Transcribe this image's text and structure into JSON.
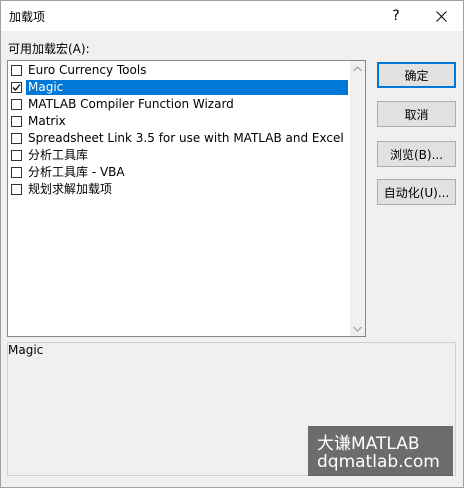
{
  "window": {
    "title": "加载项",
    "help_glyph": "?"
  },
  "addins": {
    "label": "可用加载宏(A):",
    "items": [
      {
        "label": "Euro Currency Tools",
        "checked": false,
        "selected": false
      },
      {
        "label": "Magic",
        "checked": true,
        "selected": true
      },
      {
        "label": "MATLAB Compiler Function Wizard",
        "checked": false,
        "selected": false
      },
      {
        "label": "Matrix",
        "checked": false,
        "selected": false
      },
      {
        "label": "Spreadsheet Link 3.5 for use with MATLAB and Excel",
        "checked": false,
        "selected": false
      },
      {
        "label": "分析工具库",
        "checked": false,
        "selected": false
      },
      {
        "label": "分析工具库 - VBA",
        "checked": false,
        "selected": false
      },
      {
        "label": "规划求解加载项",
        "checked": false,
        "selected": false
      }
    ]
  },
  "buttons": {
    "ok": "确定",
    "cancel": "取消",
    "browse": "浏览(B)...",
    "automation": "自动化(U)..."
  },
  "description": {
    "text": "Magic"
  },
  "watermark": {
    "line1": "大谦MATLAB",
    "line2": "dqmatlab.com"
  },
  "colors": {
    "selection": "#0078d7",
    "default_button_border": "#0078d7"
  }
}
